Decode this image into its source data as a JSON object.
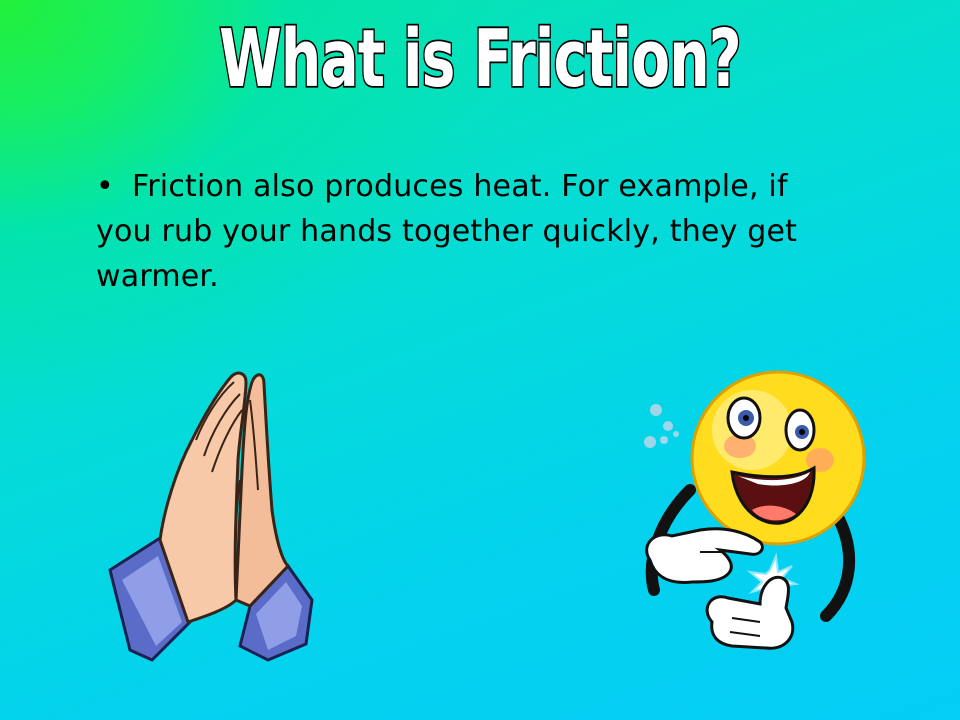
{
  "slide": {
    "title": "What is Friction?",
    "bullet_symbol": "•",
    "bullet_text": "Friction also produces heat. For example, if you rub your hands together quickly, they get warmer."
  },
  "illustrations": {
    "left": "praying-hands-icon",
    "right": "rubbing-hands-smiley-icon"
  },
  "colors": {
    "background_top_left": "#22f03a",
    "background_main": "#04d2ee",
    "title_fill": "#ffffff",
    "title_outline": "#000000",
    "text": "#000000",
    "smiley_face": "#ffdc1e",
    "skin": "#f7c9a8",
    "sleeve": "#5a6cc8"
  }
}
